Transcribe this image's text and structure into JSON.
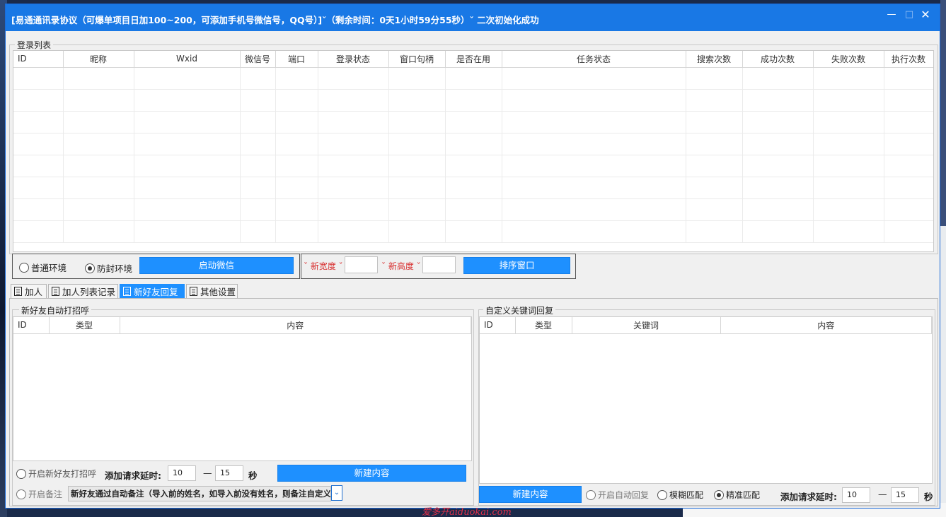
{
  "window": {
    "title": "[易通通讯录协议（可爆单项目日加100~200，可添加手机号微信号，QQ号）]ˇ（剩余时间：0天1小时59分55秒）ˇ 二次初始化成功",
    "controls": {
      "minimize": "—",
      "maximize": "□",
      "close": "✕"
    }
  },
  "login_list": {
    "legend": "登录列表",
    "columns": [
      "ID",
      "昵称",
      "Wxid",
      "微信号",
      "端口",
      "登录状态",
      "窗口句柄",
      "是否在用",
      "任务状态",
      "搜索次数",
      "成功次数",
      "失败次数",
      "执行次数"
    ],
    "rows": []
  },
  "env_bar": {
    "normal_env": "普通环境",
    "safe_env": "防封环境",
    "selected": "safe_env",
    "start_button": "启动微信"
  },
  "size_bar": {
    "width_label": "ˇ 新宽度 ˇ",
    "width_value": "",
    "height_label": "ˇ 新高度 ˇ",
    "height_value": "",
    "sort_button": "排序窗口"
  },
  "tabs": [
    {
      "label": "加人",
      "active": false
    },
    {
      "label": "加人列表记录",
      "active": false
    },
    {
      "label": "新好友回复",
      "active": true
    },
    {
      "label": "其他设置",
      "active": false
    }
  ],
  "greeting_group": {
    "legend": "新好友自动打招呼",
    "columns": [
      "ID",
      "类型",
      "内容"
    ],
    "rows": [],
    "enable_greeting": "开启新好友打招呼",
    "delay_label": "添加请求延时:",
    "delay_min": "10",
    "delay_sep": "—",
    "delay_max": "15",
    "delay_unit": "秒",
    "new_button": "新建内容",
    "enable_remark": "开启备注",
    "remark_option": "新好友通过自动备注（导入前的姓名，如导入前没有姓名，则备注自定义）"
  },
  "keyword_group": {
    "legend": "自定义关键词回复",
    "columns": [
      "ID",
      "类型",
      "关键词",
      "内容"
    ],
    "rows": [],
    "new_button": "新建内容",
    "enable_auto_reply": "开启自动回复",
    "fuzzy_match": "模糊匹配",
    "exact_match": "精准匹配",
    "match_selected": "exact",
    "delay_label": "添加请求延时:",
    "delay_min": "10",
    "delay_sep": "—",
    "delay_max": "15",
    "delay_unit": "秒"
  },
  "watermark": "爱多开aiduokai.com"
}
